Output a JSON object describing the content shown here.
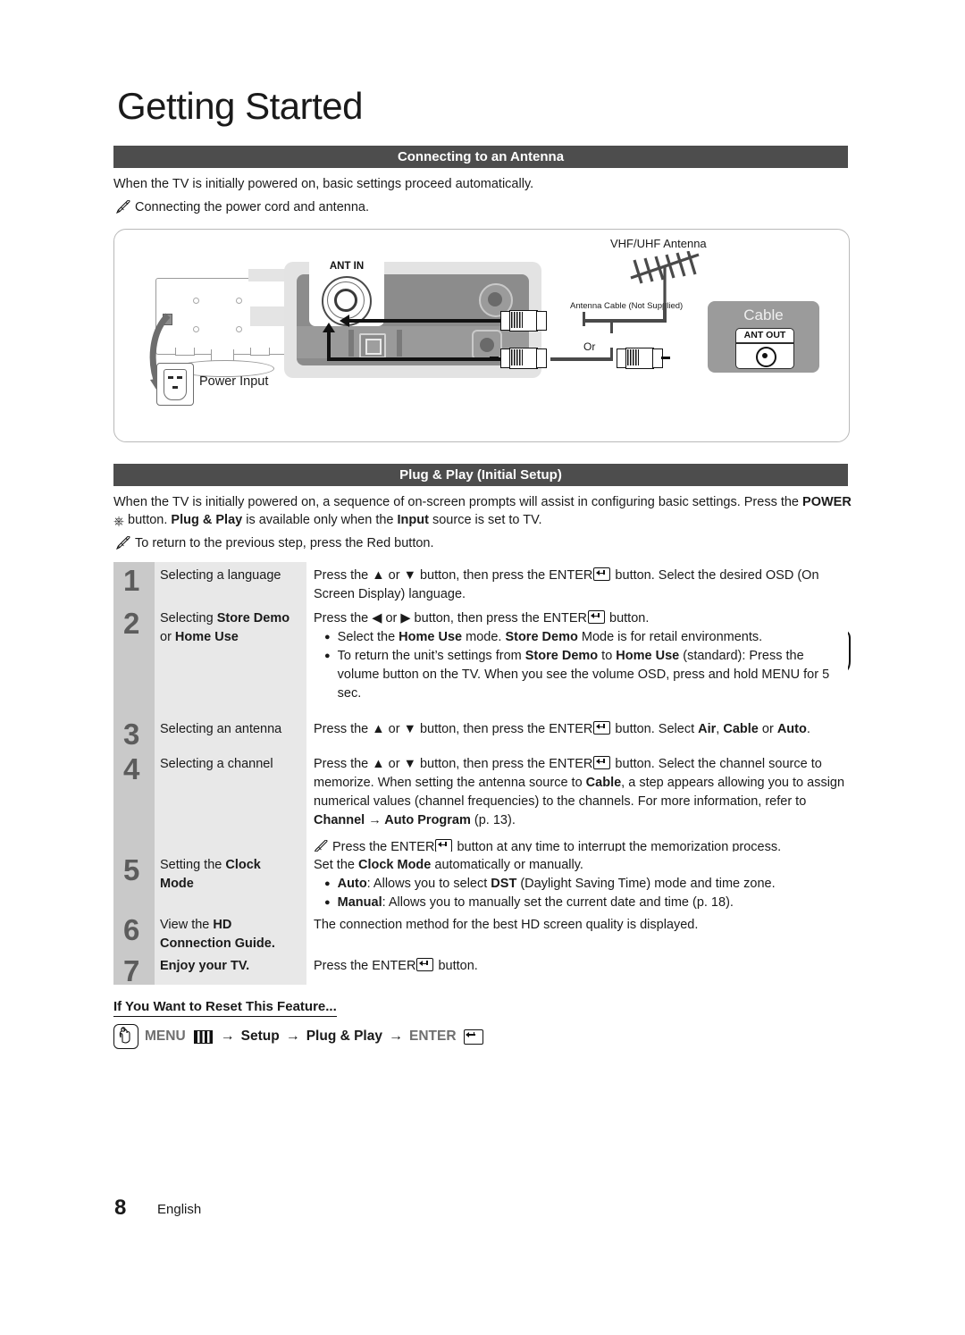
{
  "page_title": "Getting Started",
  "sections": {
    "antenna": {
      "heading": "Connecting to an Antenna",
      "paragraph": "When the TV is initially powered on, basic settings proceed automatically.",
      "note": "Connecting the power cord and antenna."
    },
    "plug_play": {
      "heading": "Plug & Play (Initial Setup)",
      "paragraph_part1": "When the TV is initially powered on, a sequence of on-screen prompts will assist in configuring basic settings. Press the ",
      "paragraph_power": "POWER",
      "paragraph_part2": " button. ",
      "paragraph_bold1": "Plug & Play",
      "paragraph_part3": " is available only when the ",
      "paragraph_bold2": "Input",
      "paragraph_part4": " source is set to TV.",
      "note": "To return to the previous step, press the Red button."
    }
  },
  "diagram": {
    "power_input_label": "Power Input",
    "ant_in_label": "ANT IN",
    "antenna_label": "VHF/UHF Antenna",
    "antenna_cable_label": "Antenna Cable (Not Supplied)",
    "or_label": "Or",
    "cable_box_title": "Cable",
    "ant_out_label": "ANT OUT"
  },
  "power_illustration": {
    "label": "POWER"
  },
  "steps": [
    {
      "number": "1",
      "label_plain": "Selecting a language",
      "desc_lines": [
        "Press the ▲ or ▼ button, then press the ENTER [key] button. Select the desired OSD (On Screen Display) language."
      ]
    },
    {
      "number": "2",
      "label_plain": "Selecting ",
      "label_bold1": "Store Demo",
      "label_plain2": "or ",
      "label_bold2": "Home Use",
      "desc_lines": [
        "Press the ◀ or ▶ button, then press the ENTER [key] button."
      ],
      "bullets": [
        "Select the Home Use mode. Store Demo Mode is for retail environments.",
        "To return the unit's settings from Store Demo to Home Use (standard): Press the volume button on the TV. When you see the volume OSD, press and hold MENU for 5 sec."
      ]
    },
    {
      "number": "3",
      "label_plain": "Selecting an antenna",
      "desc_lines": [
        "Press the ▲ or ▼ button, then press the ENTER [key] button. Select Air, Cable or Auto."
      ]
    },
    {
      "number": "4",
      "label_plain": "Selecting a channel",
      "desc_lines": [
        "Press the ▲ or ▼ button, then press the ENTER [key] button. Select the channel source to memorize. When setting the antenna source to Cable, a step appears allowing you to assign numerical values (channel frequencies) to the channels. For more information, refer to Channel → Auto Program (p. 13)."
      ],
      "note": "Press the ENTER [key] button at any time to interrupt the memorization process."
    },
    {
      "number": "5",
      "label_plain": "Setting the ",
      "label_bold1": "Clock",
      "label_bold2": "Mode",
      "desc_lines": [
        "Set the Clock Mode automatically or manually."
      ],
      "bullets": [
        "Auto: Allows you to select DST (Daylight Saving Time) mode and time zone.",
        "Manual: Allows you to manually set the current date and time (p. 18)."
      ]
    },
    {
      "number": "6",
      "label_plain": "View the ",
      "label_bold1": "HD",
      "label_bold2": "Connection Guide.",
      "desc_lines": [
        "The connection method for the best HD screen quality is displayed."
      ]
    },
    {
      "number": "7",
      "label_bold1": "Enjoy your TV.",
      "desc_lines": [
        "Press the ENTER [key] button."
      ]
    }
  ],
  "reset": {
    "heading": "If You Want to Reset This Feature...",
    "menu": "MENU",
    "arrow": "→",
    "setup": "Setup",
    "plug_play": "Plug & Play",
    "enter": "ENTER"
  },
  "footer": {
    "page_number": "8",
    "language": "English"
  },
  "colors": {
    "section_bar": "#4d4d4d",
    "step_number_bg": "#c9c9c9",
    "step_label_bg": "#e8e8e8"
  }
}
